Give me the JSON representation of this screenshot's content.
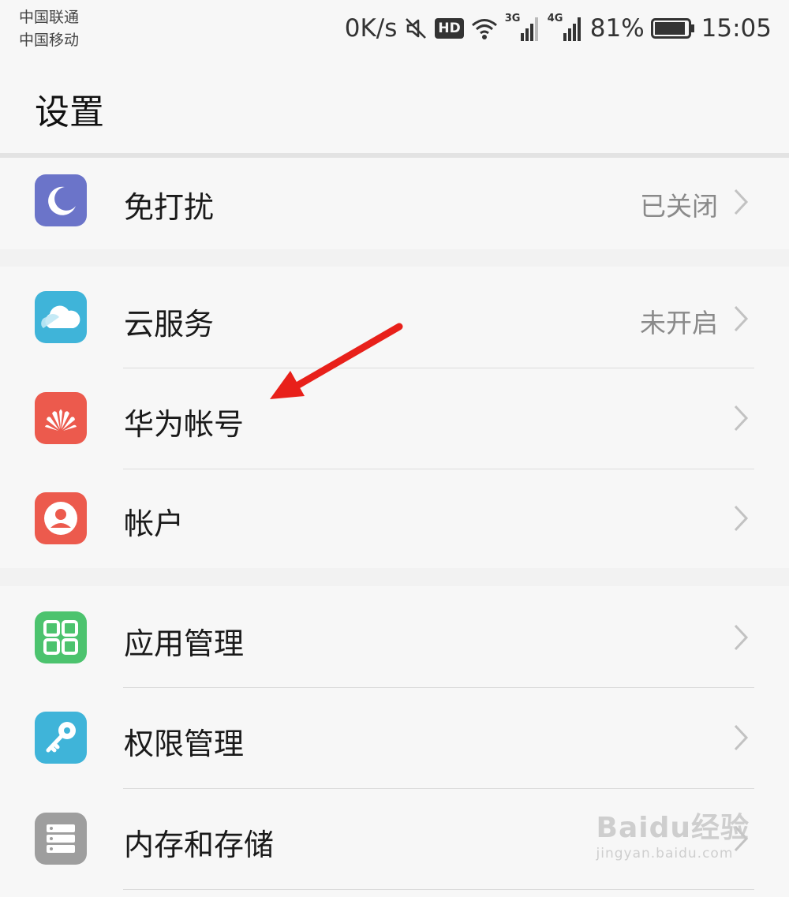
{
  "status_bar": {
    "carrier_1": "中国联通",
    "carrier_2": "中国移动",
    "net_speed": "0K/s",
    "hd_badge": "HD",
    "sig_3g": "3G",
    "sig_4g": "4G",
    "battery": "81%",
    "time": "15:05"
  },
  "page": {
    "title": "设置"
  },
  "groups": [
    {
      "items": [
        {
          "label": "免打扰",
          "value": "已关闭",
          "icon": "moon-icon",
          "icon_color": "#6b74c9"
        }
      ]
    },
    {
      "items": [
        {
          "label": "云服务",
          "value": "未开启",
          "icon": "cloud-icon",
          "icon_color": "#3fb4d9"
        },
        {
          "label": "华为帐号",
          "value": "",
          "icon": "huawei-logo-icon",
          "icon_color": "#ec5a4d"
        },
        {
          "label": "帐户",
          "value": "",
          "icon": "user-icon",
          "icon_color": "#ec5a4d"
        }
      ]
    },
    {
      "items": [
        {
          "label": "应用管理",
          "value": "",
          "icon": "apps-grid-icon",
          "icon_color": "#4cc36e"
        },
        {
          "label": "权限管理",
          "value": "",
          "icon": "key-icon",
          "icon_color": "#3fb4d9"
        },
        {
          "label": "内存和存储",
          "value": "",
          "icon": "storage-icon",
          "icon_color": "#9e9e9e"
        }
      ]
    }
  ],
  "annotation": {
    "arrow_color": "#e8201a"
  },
  "watermark": {
    "main": "Baidu经验",
    "sub": "jingyan.baidu.com"
  }
}
